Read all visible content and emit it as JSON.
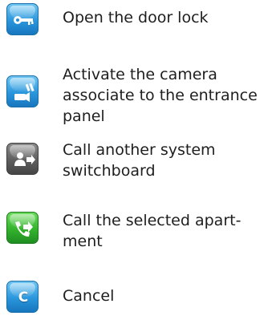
{
  "legend": {
    "items": [
      {
        "icon": "key-icon",
        "color": "#2a96dc",
        "label": "Open the door lock"
      },
      {
        "icon": "camera-icon",
        "color": "#2a96dc",
        "label": "Activate the camera associate to the entrance panel"
      },
      {
        "icon": "switchboard-call-icon",
        "color": "#5e5e5e",
        "label": "Call another system switchboard"
      },
      {
        "icon": "phone-call-icon",
        "color": "#34b32d",
        "label": "Call the selected apart-ment"
      },
      {
        "icon": "cancel-icon",
        "color": "#2a96dc",
        "glyph": "C",
        "label": "Cancel"
      }
    ]
  }
}
